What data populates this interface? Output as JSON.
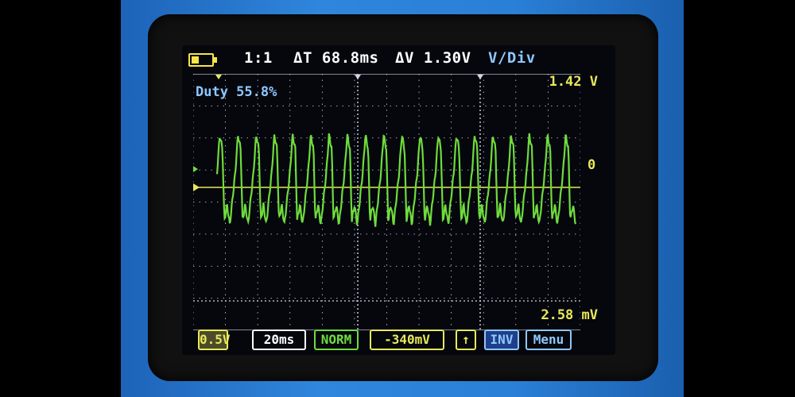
{
  "status_bar": {
    "probe_ratio": "1:1",
    "delta_t": "ΔT 68.8ms",
    "delta_v": "ΔV 1.30V",
    "mode": "V/Div"
  },
  "measurements": {
    "duty": "Duty 55.8%",
    "max_voltage": "1.42 V",
    "min_voltage": "2.58 mV",
    "zero_marker": "0"
  },
  "bottom_bar": {
    "volts_div": "0.5V",
    "time_div": "20ms",
    "trigger_mode": "NORM",
    "trigger_level": "-340mV",
    "trigger_edge": "↑",
    "invert": "INV",
    "menu": "Menu"
  },
  "colors": {
    "case_blue": "#2a7fd6",
    "trace_green": "#6fdc3c",
    "cursor_yellow": "#e8e85a",
    "grid": "#cfd6e6",
    "text_blue": "#8fc7ff"
  },
  "icons": [
    "battery-icon",
    "trigger-arrow-icon"
  ]
}
